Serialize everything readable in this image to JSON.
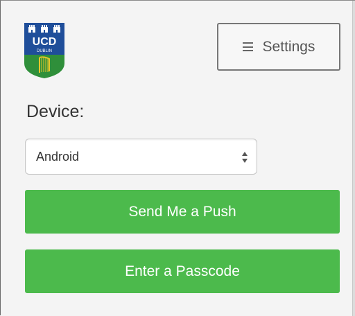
{
  "logo": {
    "text_top": "UCD",
    "text_bottom": "DUBLIN",
    "icon": "ucd-crest-icon"
  },
  "settings_button": {
    "label": "Settings",
    "icon": "hamburger-menu-icon"
  },
  "device": {
    "label": "Device:",
    "selected": "Android",
    "icon": "select-arrows-icon"
  },
  "actions": {
    "push_label": "Send Me a Push",
    "passcode_label": "Enter a Passcode"
  },
  "colors": {
    "primary_green": "#4cba4c",
    "logo_blue": "#1f4e9a",
    "logo_green": "#2f8f3a",
    "logo_yellow": "#e6c62a"
  }
}
